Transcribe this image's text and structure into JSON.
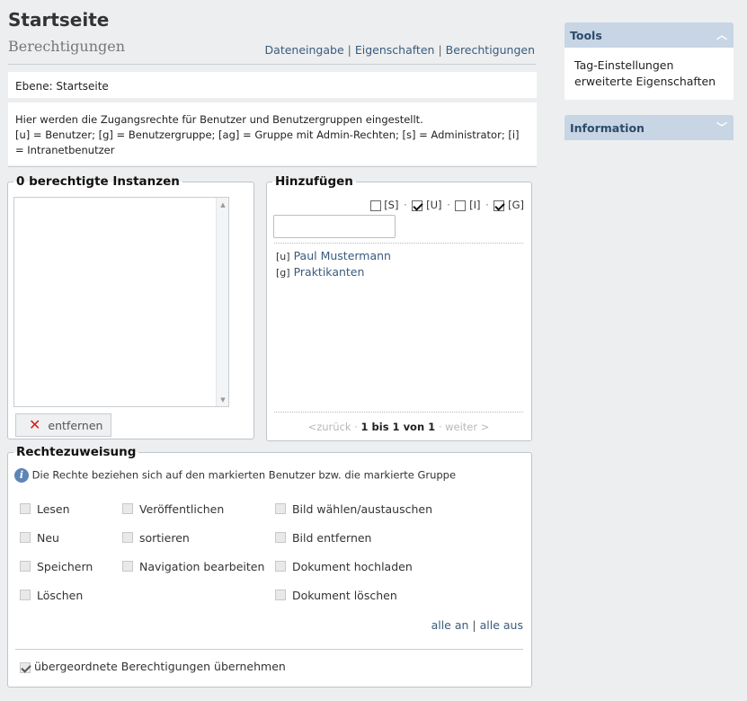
{
  "header": {
    "title": "Startseite",
    "subtitle": "Berechtigungen",
    "nav": [
      "Dateneingabe",
      "Eigenschaften",
      "Berechtigungen"
    ],
    "nav_sep": "|"
  },
  "level_text": "Ebene: Startseite",
  "info_text": {
    "line1": "Hier werden die Zugangsrechte für Benutzer und Benutzergruppen eingestellt.",
    "line2": "[u] = Benutzer; [g] = Benutzergruppe; [ag] = Gruppe mit Admin-Rechten; [s] = Administrator; [i] = Intranetbenutzer"
  },
  "instances": {
    "legend": "0 berechtigte Instanzen",
    "remove_label": "entfernen"
  },
  "add": {
    "legend": "Hinzufügen",
    "filters": [
      {
        "label": "[S]",
        "checked": false
      },
      {
        "label": "[U]",
        "checked": true
      },
      {
        "label": "[I]",
        "checked": false
      },
      {
        "label": "[G]",
        "checked": true
      }
    ],
    "filter_sep": "·",
    "search_value": "",
    "results": [
      {
        "tag": "[u]",
        "name": "Paul Mustermann"
      },
      {
        "tag": "[g]",
        "name": "Praktikanten"
      }
    ],
    "pager": {
      "prev": "<zurück",
      "sep": "·",
      "range": "1 bis 1 von 1",
      "next": "weiter >"
    }
  },
  "rights": {
    "legend": "Rechtezuweisung",
    "hint": "Die Rechte beziehen sich auf den markierten Benutzer bzw. die markierte Gruppe",
    "col1": [
      "Lesen",
      "Neu",
      "Speichern",
      "Löschen"
    ],
    "col2": [
      "Veröffentlichen",
      "sortieren",
      "Navigation bearbeiten"
    ],
    "col3": [
      "Bild wählen/austauschen",
      "Bild entfernen",
      "Dokument hochladen",
      "Dokument löschen"
    ],
    "all_on": "alle an",
    "all_off": "alle aus",
    "link_sep": "|",
    "inherit_label": "übergeordnete Berechtigungen übernehmen",
    "inherit_checked": true
  },
  "sidebar": {
    "tools": {
      "title": "Tools",
      "items": [
        "Tag-Einstellungen",
        "erweiterte Eigenschaften"
      ]
    },
    "information": {
      "title": "Information"
    }
  },
  "icons": {
    "remove": "close-x-icon",
    "info": "info-icon",
    "collapse": "chevron-up-icon",
    "expand": "chevron-down-icon"
  },
  "colors": {
    "link": "#3a5b7c",
    "panel_header": "#c7d5e4",
    "remove_x": "#d0201a",
    "info_icon": "#5d85b5"
  }
}
